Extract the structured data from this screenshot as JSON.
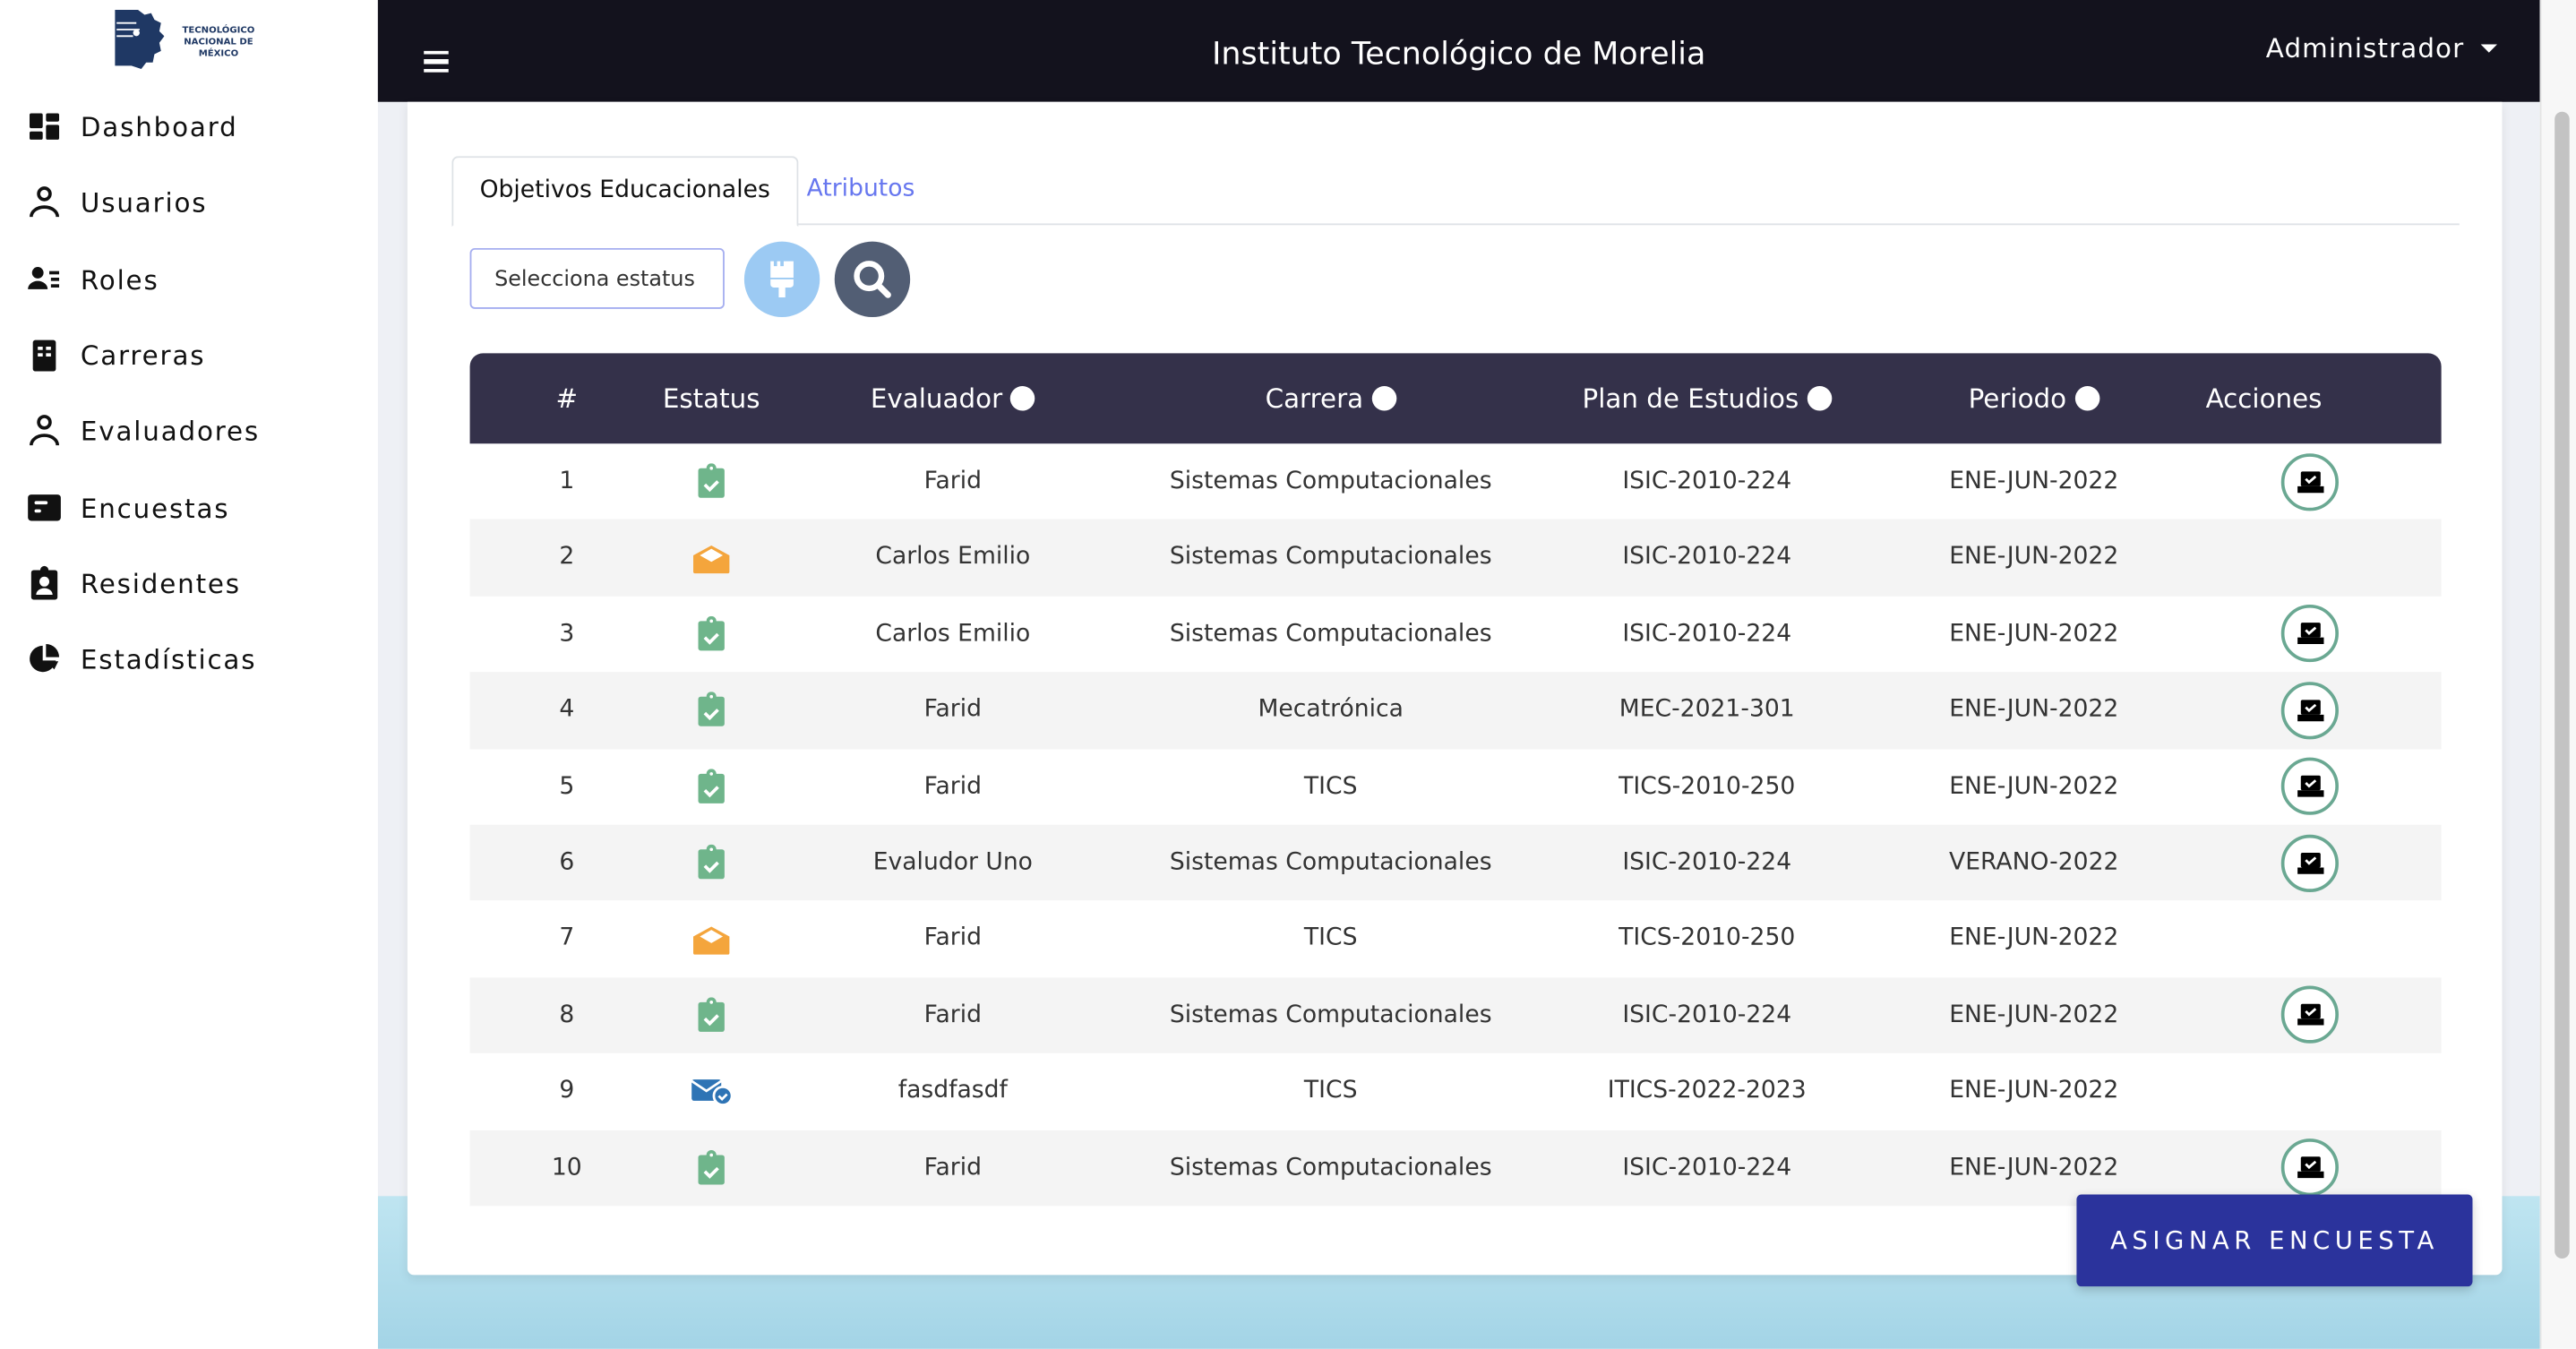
{
  "sidebar": {
    "logo_text": "TECNOLÓGICO NACIONAL DE MÉXICO",
    "items": [
      {
        "label": "Dashboard",
        "icon": "dashboard-icon"
      },
      {
        "label": "Usuarios",
        "icon": "user-icon"
      },
      {
        "label": "Roles",
        "icon": "user-list-icon"
      },
      {
        "label": "Carreras",
        "icon": "building-icon"
      },
      {
        "label": "Evaluadores",
        "icon": "user-icon"
      },
      {
        "label": "Encuestas",
        "icon": "poll-icon"
      },
      {
        "label": "Residentes",
        "icon": "clipboard-user-icon"
      },
      {
        "label": "Estadísticas",
        "icon": "pie-chart-icon"
      }
    ]
  },
  "header": {
    "title": "Instituto Tecnológico de Morelia",
    "user": "Administrador"
  },
  "tabs": [
    {
      "label": "Objetivos Educacionales",
      "active": true
    },
    {
      "label": "Atributos",
      "active": false
    }
  ],
  "filters": {
    "status_placeholder": "Selecciona estatus",
    "clear_icon": "paint-brush-icon",
    "search_icon": "search-icon"
  },
  "colors": {
    "header": "#13121d",
    "table_header": "#34314a",
    "accent": "#2b339c",
    "done": "#6fb58b",
    "pending": "#f4a53c",
    "sent": "#2e74b5"
  },
  "table": {
    "columns": [
      "#",
      "Estatus",
      "Evaluador",
      "Carrera",
      "Plan de Estudios",
      "Periodo",
      "Acciones"
    ],
    "rows": [
      {
        "n": "1",
        "status": "completed",
        "evaluador": "Farid",
        "carrera": "Sistemas Computacionales",
        "plan": "ISIC-2010-224",
        "periodo": "ENE-JUN-2022",
        "action": true
      },
      {
        "n": "2",
        "status": "opened",
        "evaluador": "Carlos Emilio",
        "carrera": "Sistemas Computacionales",
        "plan": "ISIC-2010-224",
        "periodo": "ENE-JUN-2022",
        "action": false
      },
      {
        "n": "3",
        "status": "completed",
        "evaluador": "Carlos Emilio",
        "carrera": "Sistemas Computacionales",
        "plan": "ISIC-2010-224",
        "periodo": "ENE-JUN-2022",
        "action": true
      },
      {
        "n": "4",
        "status": "completed",
        "evaluador": "Farid",
        "carrera": "Mecatrónica",
        "plan": "MEC-2021-301",
        "periodo": "ENE-JUN-2022",
        "action": true
      },
      {
        "n": "5",
        "status": "completed",
        "evaluador": "Farid",
        "carrera": "TICS",
        "plan": "TICS-2010-250",
        "periodo": "ENE-JUN-2022",
        "action": true
      },
      {
        "n": "6",
        "status": "completed",
        "evaluador": "Evaludor Uno",
        "carrera": "Sistemas Computacionales",
        "plan": "ISIC-2010-224",
        "periodo": "VERANO-2022",
        "action": true
      },
      {
        "n": "7",
        "status": "opened",
        "evaluador": "Farid",
        "carrera": "TICS",
        "plan": "TICS-2010-250",
        "periodo": "ENE-JUN-2022",
        "action": false
      },
      {
        "n": "8",
        "status": "completed",
        "evaluador": "Farid",
        "carrera": "Sistemas Computacionales",
        "plan": "ISIC-2010-224",
        "periodo": "ENE-JUN-2022",
        "action": true
      },
      {
        "n": "9",
        "status": "sent",
        "evaluador": "fasdfasdf",
        "carrera": "TICS",
        "plan": "ITICS-2022-2023",
        "periodo": "ENE-JUN-2022",
        "action": false
      },
      {
        "n": "10",
        "status": "completed",
        "evaluador": "Farid",
        "carrera": "Sistemas Computacionales",
        "plan": "ISIC-2010-224",
        "periodo": "ENE-JUN-2022",
        "action": true
      }
    ]
  },
  "assign_button": "ASIGNAR ENCUESTA"
}
